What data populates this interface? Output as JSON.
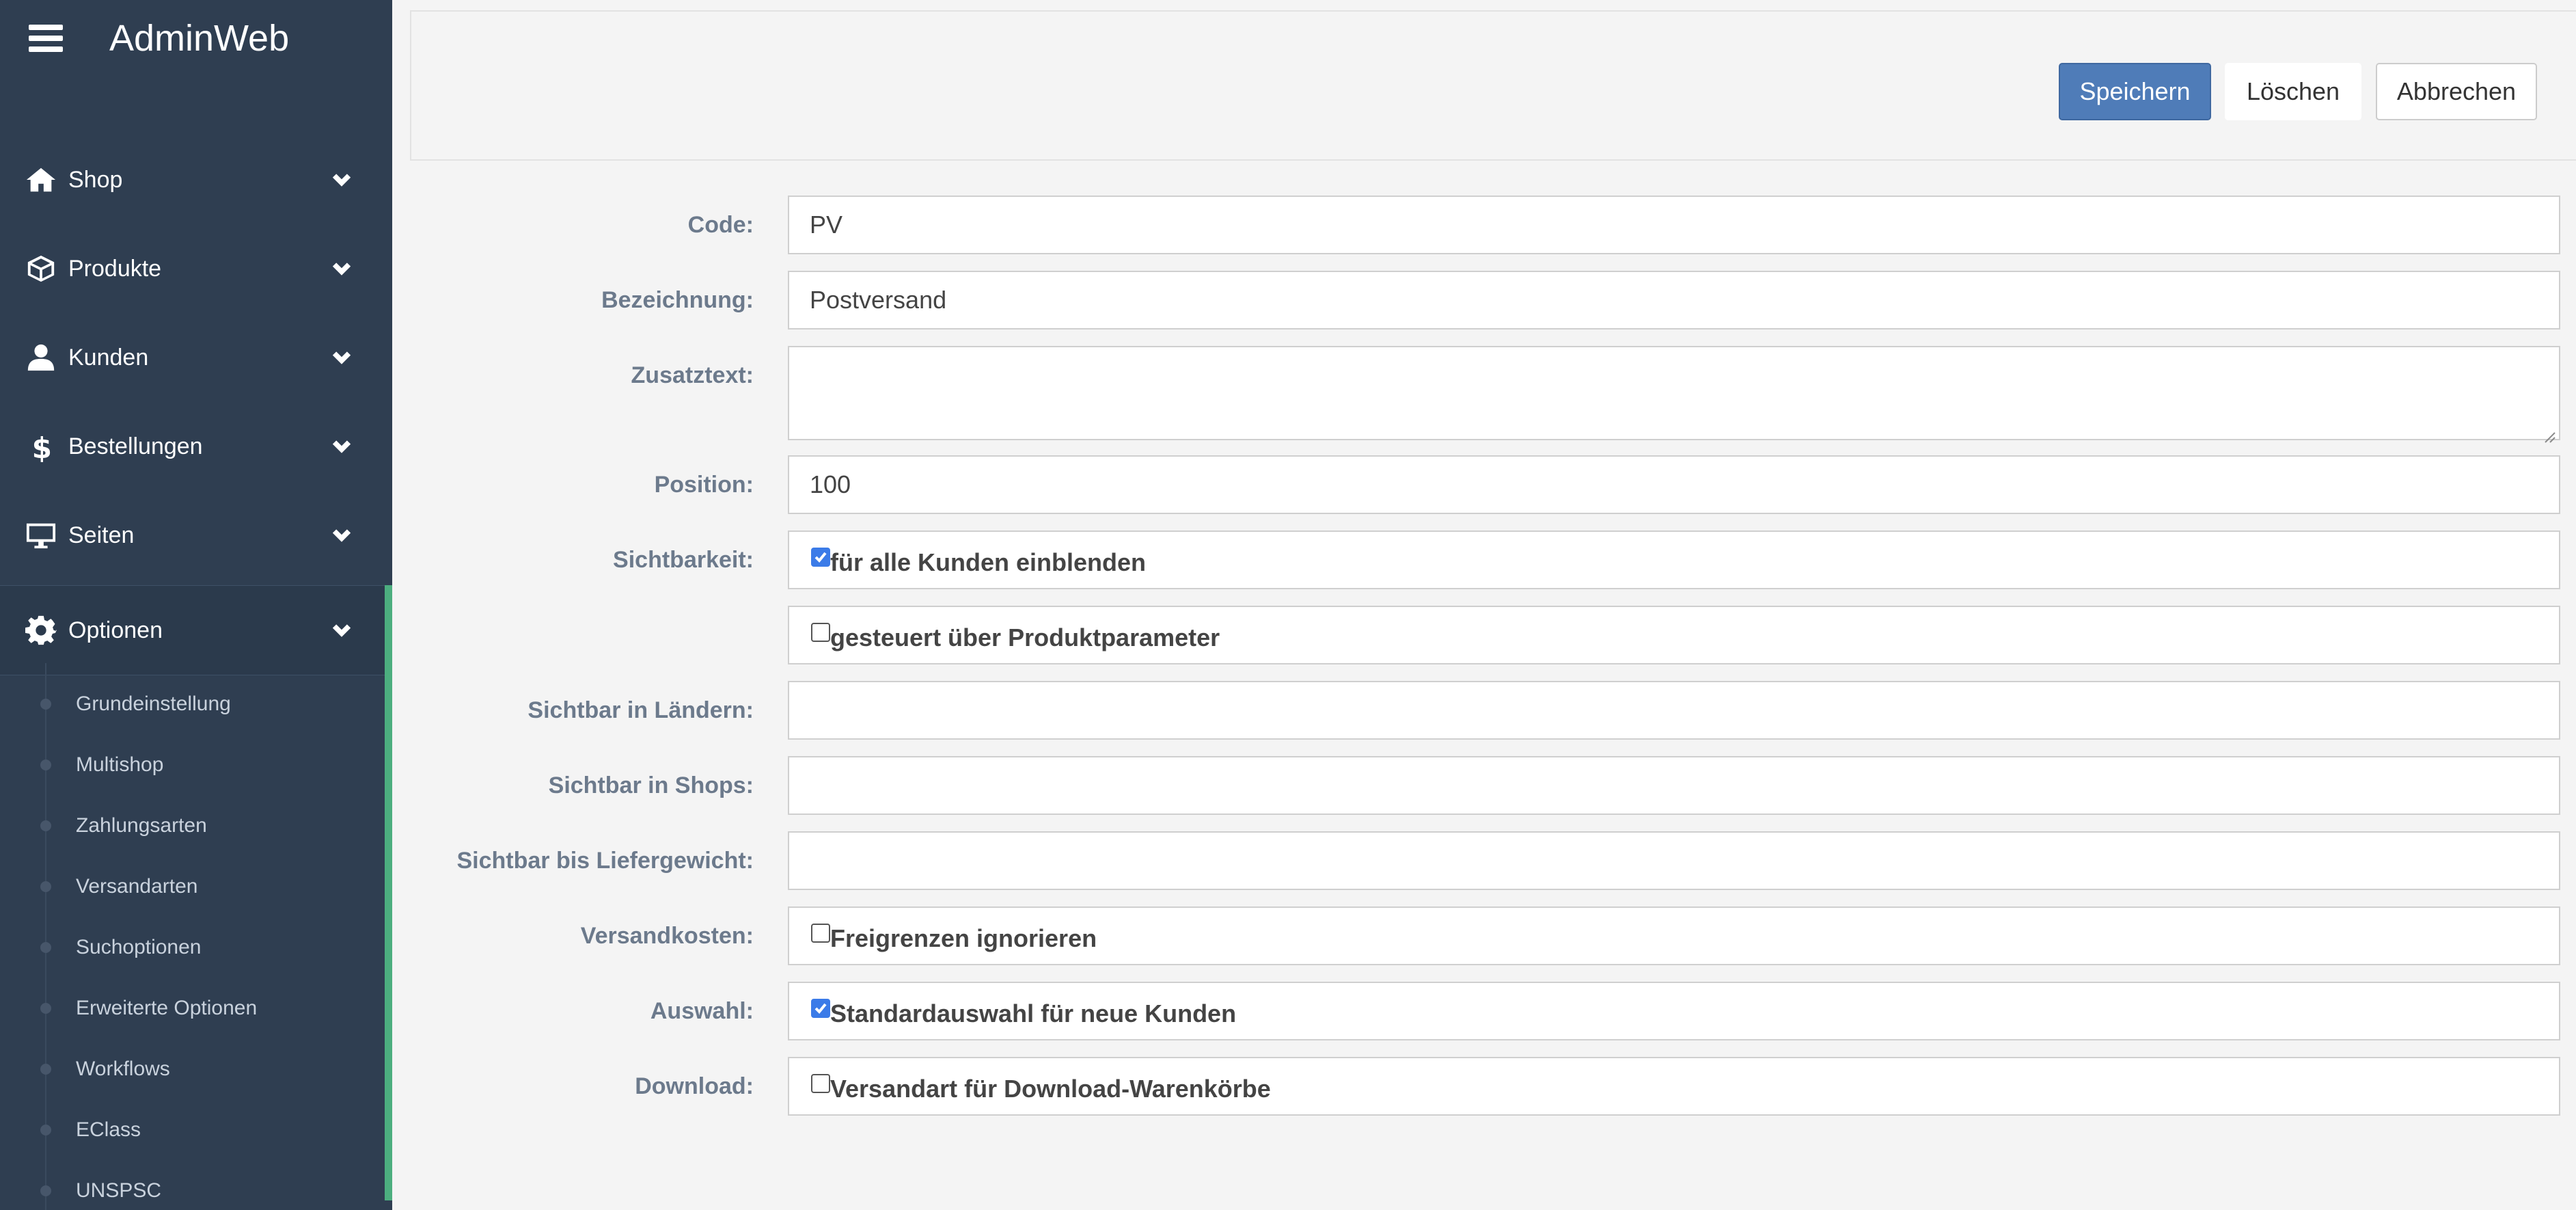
{
  "app": {
    "title": "AdminWeb"
  },
  "sidebar": {
    "items": [
      {
        "label": "Shop",
        "icon": "home-icon"
      },
      {
        "label": "Produkte",
        "icon": "box-icon"
      },
      {
        "label": "Kunden",
        "icon": "user-icon"
      },
      {
        "label": "Bestellungen",
        "icon": "dollar-icon"
      },
      {
        "label": "Seiten",
        "icon": "monitor-icon"
      },
      {
        "label": "Optionen",
        "icon": "gear-icon",
        "active": true
      }
    ],
    "sub_items": [
      "Grundeinstellung",
      "Multishop",
      "Zahlungsarten",
      "Versandarten",
      "Suchoptionen",
      "Erweiterte Optionen",
      "Workflows",
      "EClass",
      "UNSPSC"
    ]
  },
  "toolbar": {
    "save_label": "Speichern",
    "delete_label": "Löschen",
    "cancel_label": "Abbrechen"
  },
  "form": {
    "code": {
      "label": "Code:",
      "value": "PV"
    },
    "bezeichnung": {
      "label": "Bezeichnung:",
      "value": "Postversand"
    },
    "zusatztext": {
      "label": "Zusatztext:",
      "value": ""
    },
    "position": {
      "label": "Position:",
      "value": "100"
    },
    "sichtbarkeit": {
      "label": "Sichtbarkeit:",
      "option1": {
        "text": "für alle Kunden einblenden",
        "checked": true
      },
      "option2": {
        "text": "gesteuert über Produktparameter",
        "checked": false
      }
    },
    "laender": {
      "label": "Sichtbar in Ländern:",
      "value": ""
    },
    "shops": {
      "label": "Sichtbar in Shops:",
      "value": ""
    },
    "liefergewicht": {
      "label": "Sichtbar bis Liefergewicht:",
      "value": ""
    },
    "versandkosten": {
      "label": "Versandkosten:",
      "option": {
        "text": "Freigrenzen ignorieren",
        "checked": false
      }
    },
    "auswahl": {
      "label": "Auswahl:",
      "option": {
        "text": "Standardauswahl für neue Kunden",
        "checked": true
      }
    },
    "download": {
      "label": "Download:",
      "option": {
        "text": "Versandart für Download-Warenkörbe",
        "checked": false
      }
    }
  },
  "colors": {
    "sidebar_bg": "#2f3e51",
    "accent_green": "#4cae7f",
    "primary_button": "#4f7cb8",
    "checkbox_checked": "#3b7be8"
  }
}
